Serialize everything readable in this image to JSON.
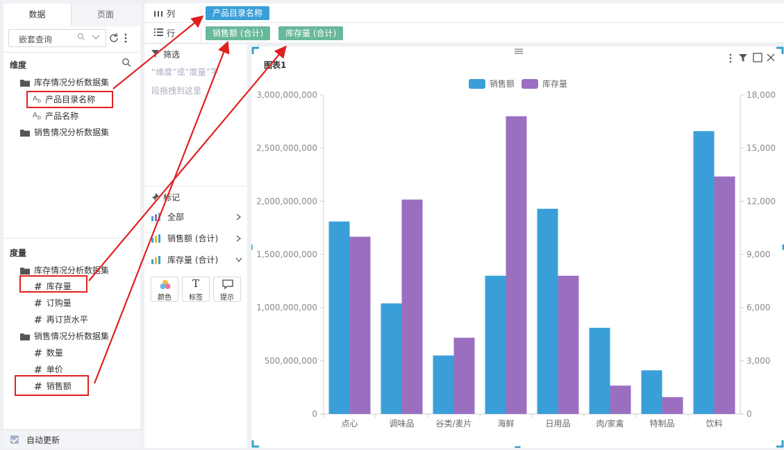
{
  "left_panel": {
    "tabs": [
      "数据",
      "页面"
    ],
    "search_placeholder": "嵌套查询",
    "dimensions_title": "维度",
    "measures_title": "度量",
    "dim_tree": [
      {
        "label": "库存情况分析数据集",
        "type": "folder"
      },
      {
        "label": "产品目录名称",
        "type": "text"
      },
      {
        "label": "产品名称",
        "type": "text"
      },
      {
        "label": "销售情况分析数据集",
        "type": "folder"
      }
    ],
    "measure_tree": [
      {
        "label": "库存情况分析数据集",
        "type": "folder"
      },
      {
        "label": "库存量",
        "type": "number"
      },
      {
        "label": "订购量",
        "type": "number"
      },
      {
        "label": "再订货水平",
        "type": "number"
      },
      {
        "label": "销售情况分析数据集",
        "type": "folder"
      },
      {
        "label": "数量",
        "type": "number"
      },
      {
        "label": "单价",
        "type": "number"
      },
      {
        "label": "销售额",
        "type": "number"
      }
    ],
    "auto_update": "自动更新"
  },
  "shelf": {
    "columns_label": "列",
    "rows_label": "行",
    "column_pills": [
      "产品目录名称"
    ],
    "row_pills": [
      "销售额 (合计)",
      "库存量 (合计)"
    ]
  },
  "middle_panel": {
    "filter_title": "筛选",
    "filter_hint_1": "“维度”或“度量”字",
    "filter_hint_2": "段拖拽到这里",
    "marks_title": "标记",
    "marks_items": [
      "全部",
      "销售额 (合计)",
      "库存量 (合计)"
    ],
    "mark_buttons": [
      "颜色",
      "标签",
      "提示"
    ]
  },
  "chart_data": {
    "type": "bar",
    "title": "图表1",
    "categories": [
      "点心",
      "调味品",
      "谷类/麦片",
      "海鲜",
      "日用品",
      "肉/家禽",
      "特制品",
      "饮料"
    ],
    "series": [
      {
        "name": "销售额",
        "axis": "left",
        "color": "#3a9fd8",
        "values": [
          1810000000,
          1040000000,
          550000000,
          1300000000,
          1930000000,
          810000000,
          410000000,
          2660000000
        ]
      },
      {
        "name": "库存量",
        "axis": "right",
        "color": "#9a6fbf",
        "values": [
          10000,
          12100,
          4300,
          16800,
          7800,
          1600,
          950,
          13400
        ]
      }
    ],
    "left_axis": {
      "range": [
        0,
        3000000000
      ],
      "ticks": [
        "0",
        "500,000,000",
        "1,000,000,000",
        "1,500,000,000",
        "2,000,000,000",
        "2,500,000,000",
        "3,000,000,000"
      ]
    },
    "right_axis": {
      "range": [
        0,
        18000
      ],
      "ticks": [
        "0",
        "3,000",
        "6,000",
        "9,000",
        "12,000",
        "15,000",
        "18,000"
      ]
    },
    "legend_position": "top-center",
    "grid": false
  }
}
